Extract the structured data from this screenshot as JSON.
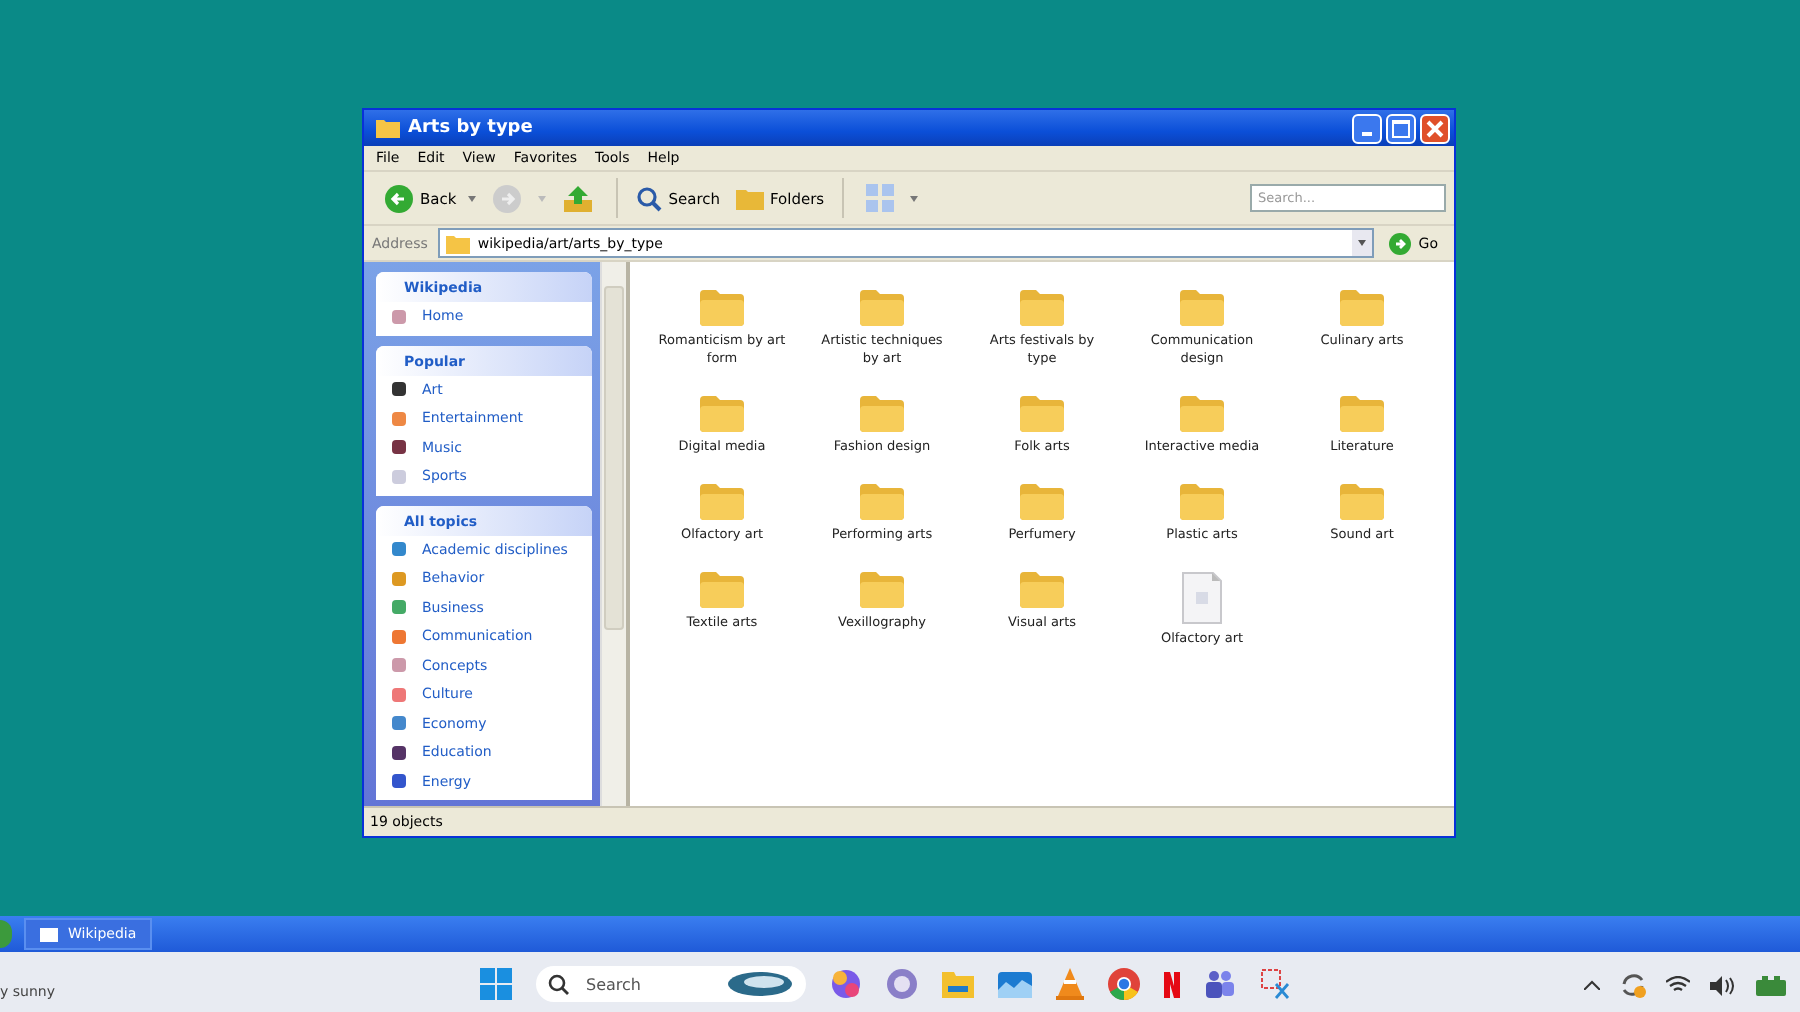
{
  "window": {
    "title": "Arts by type",
    "menu": [
      "File",
      "Edit",
      "View",
      "Favorites",
      "Tools",
      "Help"
    ],
    "toolbar": {
      "back": "Back",
      "search": "Search",
      "folders": "Folders",
      "search_placeholder": "Search..."
    },
    "address": {
      "label": "Address",
      "value": "wikipedia/art/arts_by_type",
      "go": "Go"
    },
    "sidebar": [
      {
        "title": "Wikipedia",
        "items": [
          "Home"
        ]
      },
      {
        "title": "Popular",
        "items": [
          "Art",
          "Entertainment",
          "Music",
          "Sports"
        ]
      },
      {
        "title": "All topics",
        "items": [
          "Academic disciplines",
          "Behavior",
          "Business",
          "Communication",
          "Concepts",
          "Culture",
          "Economy",
          "Education",
          "Energy"
        ]
      }
    ],
    "items": [
      {
        "name": "Romanticism by art form",
        "kind": "folder"
      },
      {
        "name": "Artistic techniques by art",
        "kind": "folder"
      },
      {
        "name": "Arts festivals by type",
        "kind": "folder"
      },
      {
        "name": "Communication design",
        "kind": "folder"
      },
      {
        "name": "Culinary arts",
        "kind": "folder"
      },
      {
        "name": "Digital media",
        "kind": "folder"
      },
      {
        "name": "Fashion design",
        "kind": "folder"
      },
      {
        "name": "Folk arts",
        "kind": "folder"
      },
      {
        "name": "Interactive media",
        "kind": "folder"
      },
      {
        "name": "Literature",
        "kind": "folder"
      },
      {
        "name": "Olfactory art",
        "kind": "folder"
      },
      {
        "name": "Performing arts",
        "kind": "folder"
      },
      {
        "name": "Perfumery",
        "kind": "folder"
      },
      {
        "name": "Plastic arts",
        "kind": "folder"
      },
      {
        "name": "Sound art",
        "kind": "folder"
      },
      {
        "name": "Textile arts",
        "kind": "folder"
      },
      {
        "name": "Vexillography",
        "kind": "folder"
      },
      {
        "name": "Visual arts",
        "kind": "folder"
      },
      {
        "name": "Olfactory art",
        "kind": "file"
      }
    ],
    "status": "19 objects"
  },
  "xp_taskbar": {
    "task": "Wikipedia"
  },
  "taskbar": {
    "weather": "y sunny",
    "search_placeholder": "Search"
  }
}
